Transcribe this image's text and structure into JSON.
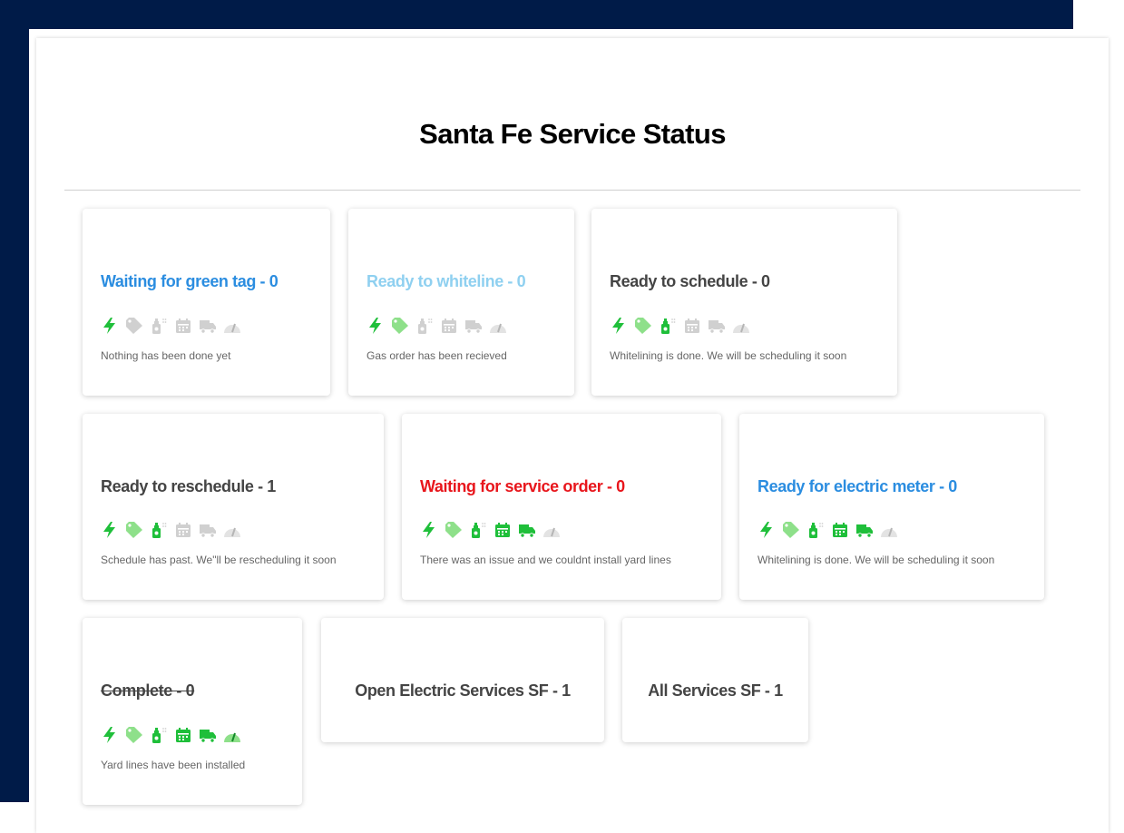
{
  "page": {
    "title": "Santa Fe Service Status"
  },
  "colors": {
    "navy": "#001b48",
    "active_green": "#1fbf3a",
    "light_green": "#8ee08a",
    "inactive_gray": "#d0d0d0",
    "blue": "#2b8de0",
    "light_blue": "#8fd0f0",
    "red": "#e8161c",
    "dark": "#444444"
  },
  "cards": [
    {
      "title": "Waiting for green tag - 0",
      "description": "Nothing has been done yet",
      "icons": [
        "active",
        "inactive",
        "inactive",
        "inactive",
        "inactive",
        "inactive"
      ]
    },
    {
      "title": "Ready to whiteline - 0",
      "description": "Gas order has been recieved",
      "icons": [
        "active",
        "active",
        "inactive",
        "inactive",
        "inactive",
        "inactive"
      ]
    },
    {
      "title": "Ready to schedule - 0",
      "description": "Whitelining is done. We will be scheduling it soon",
      "icons": [
        "active",
        "active",
        "active",
        "inactive",
        "inactive",
        "inactive"
      ]
    },
    {
      "title": "Ready to reschedule - 1",
      "description": "Schedule has past. We\"ll be rescheduling it soon",
      "icons": [
        "active",
        "active",
        "active",
        "inactive",
        "inactive",
        "inactive"
      ]
    },
    {
      "title": "Waiting for service order - 0",
      "description": "There was an issue and we couldnt install yard lines",
      "icons": [
        "active",
        "active",
        "active",
        "active",
        "active",
        "inactive"
      ]
    },
    {
      "title": "Ready for electric meter - 0",
      "description": "Whitelining is done. We will be scheduling it soon",
      "icons": [
        "active",
        "active",
        "active",
        "active",
        "active",
        "inactive"
      ]
    },
    {
      "title": "Complete - 0",
      "description": "Yard lines have been installed",
      "icons": [
        "active",
        "active",
        "active",
        "active",
        "active",
        "active"
      ]
    },
    {
      "title": "Open Electric Services SF - 1"
    },
    {
      "title": "All Services SF - 1"
    }
  ],
  "icon_names": [
    "lightning-icon",
    "tag-icon",
    "spray-can-icon",
    "calendar-icon",
    "truck-icon",
    "meter-gauge-icon"
  ]
}
